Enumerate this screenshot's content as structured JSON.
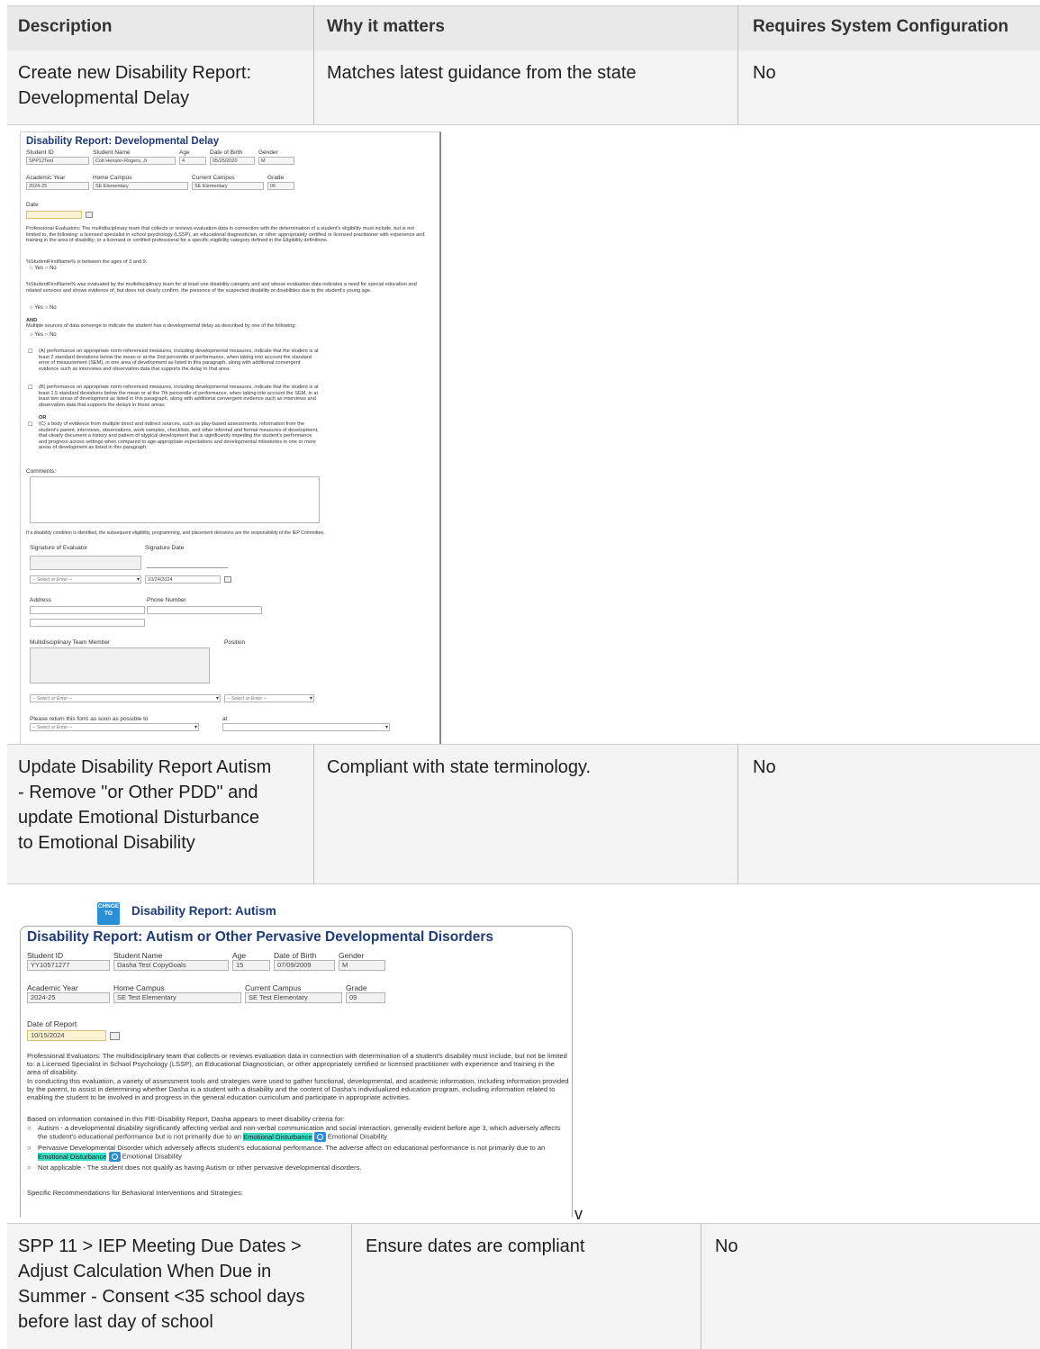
{
  "table": {
    "headers": [
      "Description",
      "Why it matters",
      "Requires System Configuration"
    ],
    "rows": [
      {
        "description_lines": [
          "Create new Disability Report:",
          "Developmental Delay"
        ],
        "why": "Matches latest guidance from the state",
        "config": "No"
      },
      {
        "description_lines": [
          "Update Disability Report Autism",
          "- Remove \"or Other PDD\" and",
          "update Emotional Disturbance",
          "to Emotional Disability"
        ],
        "why": "Compliant with state terminology.",
        "config": "No"
      },
      {
        "description_lines": [
          "SPP 11 > IEP Meeting Due Dates >",
          "Adjust Calculation When Due in",
          "Summer - Consent <35 school days",
          "before last day of school"
        ],
        "why": "Ensure dates are compliant",
        "config": "No"
      }
    ],
    "stray_mark": "v"
  },
  "form1": {
    "title": "Disability Report: Developmental Delay",
    "labels": {
      "student_id": "Student ID",
      "student_name": "Student Name",
      "age": "Age",
      "dob": "Date of Birth",
      "gender": "Gender",
      "academic_year": "Academic Year",
      "home_campus": "Home Campus",
      "current_campus": "Current Campus",
      "grade": "Grade",
      "date": "Date",
      "comments": "Comments:",
      "signature": "Signature of Evaluator",
      "signature_date": "Signature Date",
      "address": "Address",
      "phone": "Phone Number",
      "team_member": "Multidisciplinary Team Member",
      "position": "Position",
      "return": "Please return this form as soon as possible to",
      "at": "at"
    },
    "values": {
      "student_id": "SPP12Test",
      "student_name": "Colt Henson-Rogers, Jr",
      "age": "4",
      "dob": "05/25/2020",
      "gender": "M",
      "academic_year": "2024-25",
      "home_campus": "SE Elementary",
      "current_campus": "SE Elementary",
      "grade": "06",
      "signature_date": "10/24/2024"
    },
    "select_placeholder": "-- Select or Enter --",
    "professional_evaluators": "Professional Evaluators: The multidisciplinary team that collects or reviews evaluation data in connection with the determination of a student's eligibility must include, but is not limited to, the following: a licensed specialist in school psychology (LSSP), an educational diagnostician, or other appropriately certified or licensed practitioner with experience and training in the area of disability; or a licensed or certified professional for a specific eligibility category defined in the Eligibility definitions.",
    "q1": "%StudentFirstName% is between the ages of 3 and 9.",
    "q2": "%StudentFirstName% was evaluated by the multidisciplinary team for at least one disability category and and whose evaluation data indicates a need for special education and related services and shows evidence of, but does not clearly confirm, the presence of the suspected disability or disabilities due to the student's young age.",
    "and_label": "AND",
    "q3": "Multiple sources of data converge to indicate the student has a developmental delay as described by one of the following:",
    "yes": "Yes",
    "no": "No",
    "opt_a": "(A) performance on appropriate norm-referenced measures, including developmental measures, indicate that the student is at least 2 standard deviations below the mean or at the 2nd percentile of performance, when taking into account the standard error of measurement (SEM), in one area of development as listed in this paragraph, along with additional convergent evidence such as interviews and observation data that supports the delay in that area;",
    "opt_b": "(B) performance on appropriate norm-referenced measures, including developmental measures, indicate that the student is at least 1.5 standard deviations below the mean or at the 7th percentile of performance, when taking into account the SEM, in at least two areas of development as listed in this paragraph, along with additional convergent evidence such as interviews and observation data that supports the delays in those areas;",
    "or_label": "OR",
    "opt_c": "(C) a body of evidence from multiple direct and indirect sources, such as play-based assessments, information from the student's parent, interviews, observations, work samples, checklists, and other informal and formal measures of development, that clearly document a history and pattern of atypical development that is significantly impeding the student's performance and progress across settings when compared to age-appropriate expectations and developmental milestones in one or more areas of development as listed in this paragraph.",
    "iep_note": "If a disability condition is identified, the subsequent eligibility, programming, and placement decisions are the responsibility of the IEP Committee."
  },
  "form2": {
    "change_badge": "CHNGE TO",
    "banner": "Disability Report: Autism",
    "title": "Disability Report: Autism or Other Pervasive Developmental Disorders",
    "labels": {
      "student_id": "Student ID",
      "student_name": "Student Name",
      "age": "Age",
      "dob": "Date of Birth",
      "gender": "Gender",
      "academic_year": "Academic Year",
      "home_campus": "Home Campus",
      "current_campus": "Current Campus",
      "grade": "Grade",
      "date_of_report": "Date of Report"
    },
    "values": {
      "student_id": "YY10571277",
      "student_name": "Dasha Test CopyGoals",
      "age": "15",
      "dob": "07/09/2009",
      "gender": "M",
      "academic_year": "2024-25",
      "home_campus": "SE Test Elementary",
      "current_campus": "SE Test Elementary",
      "grade": "09",
      "date_of_report": "10/15/2024"
    },
    "p1": "Professional Evaluators: The multidisciplinary team that collects or reviews evaluation data in connection with determination of a student's disability must include, but not be limited to: a Licensed Specialist in School Psychology (LSSP), an Educational Diagnostician, or other appropriately certified or licensed practitioner with experience and training in the area of disability.",
    "p2": "In conducting this evaluation, a variety of assessment tools and strategies were used to gather functional, developmental, and academic information, including information provided by the parent, to assist in determining whether Dasha is a student with a disability and the content of Dasha's individualized education program, including information related to enabling the student to be involved in and progress in the general education curriculum and participate in appropriate activities.",
    "p3": "Based on information contained in this FIE-Disability Report, Dasha appears to meet disability criteria for:",
    "o1_a": "Autism - a developmental disability significantly affecting verbal and non-verbal communication and social interaction, generally evident before age 3, which adversely affects the student's educational performance but is not primarily due to an",
    "o2_a": "Pervasive Developmental Disorder which adversely affects student's educational performance. The adverse affect on educational performance is not primarily due to an",
    "highlight": "Emotional Disturbance",
    "replacement": "Emotional Disability",
    "o3": "Not applicable - The student does not qualify as having Autism or other pervasive developmental disorders.",
    "p4": "Specific Recommendations for Behavioral Interventions and Strategies:"
  }
}
